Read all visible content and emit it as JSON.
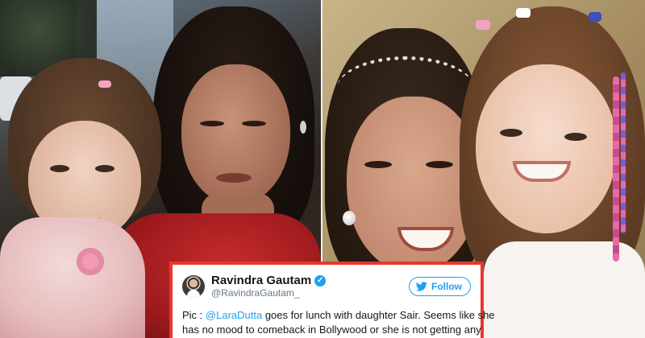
{
  "tweet": {
    "name": "Ravindra Gautam",
    "handle": "@RavindraGautam_",
    "verified_glyph": "✓",
    "follow_label": "Follow",
    "follow_color": "#1da1f2",
    "border_color": "#e8372e",
    "text": {
      "prefix": "Pic : ",
      "mention": "@LaraDutta",
      "line1_rest": " goes for lunch with daughter Sair. Seems like she",
      "line2": "has no mood to comeback in Bollywood or she is not getting any"
    }
  },
  "icons": {
    "avatar": "profile-photo",
    "verified": "verified-badge-icon",
    "follow": "twitter-bird-icon"
  }
}
